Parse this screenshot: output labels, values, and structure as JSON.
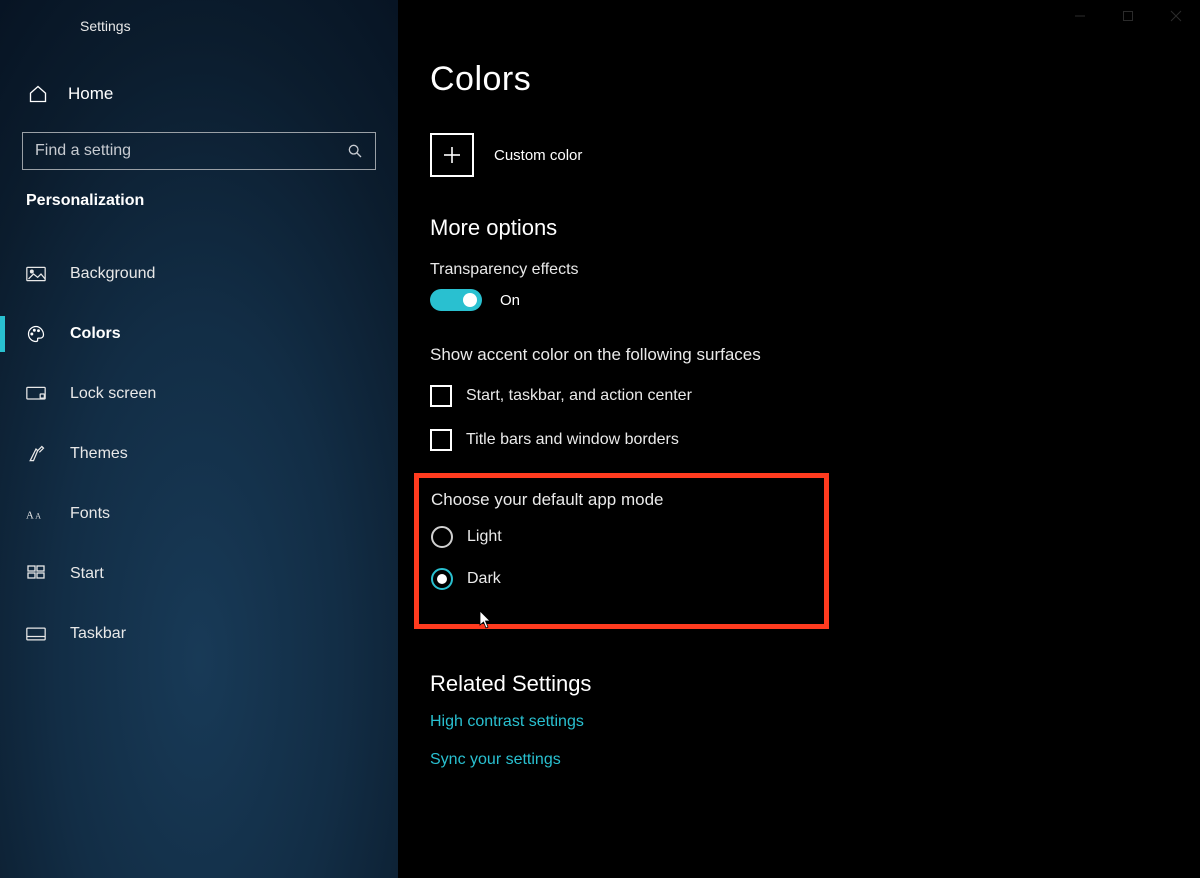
{
  "window": {
    "title": "Settings"
  },
  "sidebar": {
    "home_label": "Home",
    "search_placeholder": "Find a setting",
    "section_label": "Personalization",
    "items": [
      {
        "label": "Background"
      },
      {
        "label": "Colors"
      },
      {
        "label": "Lock screen"
      },
      {
        "label": "Themes"
      },
      {
        "label": "Fonts"
      },
      {
        "label": "Start"
      },
      {
        "label": "Taskbar"
      }
    ],
    "selected": 1
  },
  "main": {
    "title": "Colors",
    "custom_color_label": "Custom color",
    "more_options_heading": "More options",
    "transparency": {
      "label": "Transparency effects",
      "state_label": "On"
    },
    "accent": {
      "label": "Show accent color on the following surfaces",
      "options": [
        "Start, taskbar, and action center",
        "Title bars and window borders"
      ]
    },
    "mode": {
      "label": "Choose your default app mode",
      "options": [
        "Light",
        "Dark"
      ],
      "selected": 1
    },
    "related": {
      "heading": "Related Settings",
      "links": [
        "High contrast settings",
        "Sync your settings"
      ]
    }
  },
  "accent_color": "#29c0d0"
}
